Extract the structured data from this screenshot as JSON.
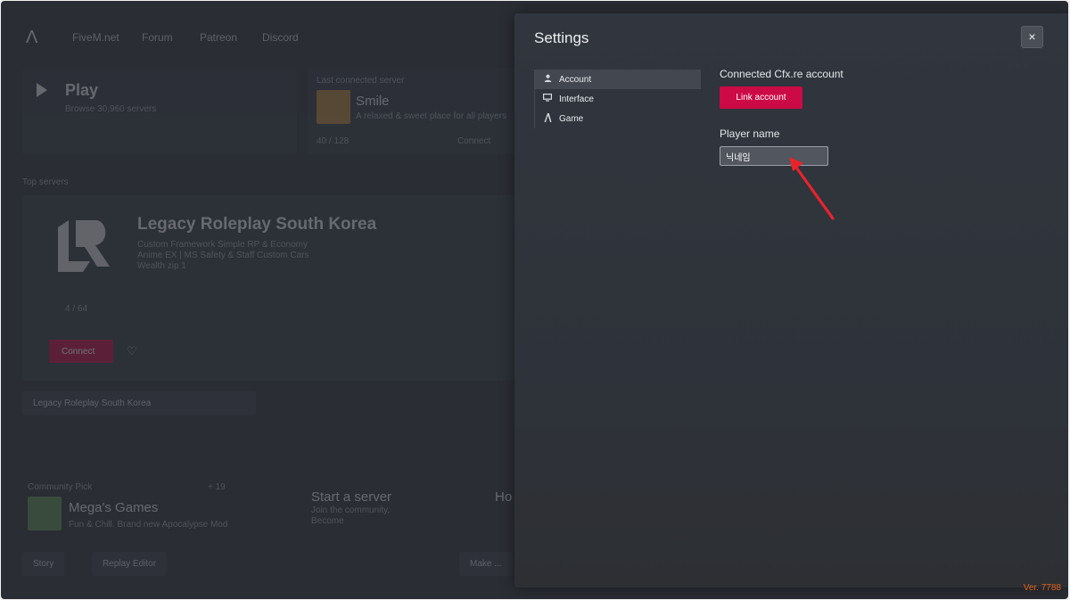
{
  "background": {
    "nav": [
      "FiveM.net",
      "Forum",
      "Patreon",
      "Discord"
    ],
    "play": {
      "title": "Play",
      "subtitle": "Browse 30,960 servers"
    },
    "featured": {
      "label": "Last connected server",
      "title": "Smile",
      "desc": "A relaxed & sweet place for all players",
      "players": "40 / 128",
      "connect": "Connect"
    },
    "top_servers_label": "Top servers",
    "top_server": {
      "title": "Legacy Roleplay South Korea",
      "desc_lines": [
        "Custom Framework Simple RP & Economy",
        "Anime EX | MS Safety & Staff Custom Cars",
        "Wealth zip 1"
      ],
      "players": "4 / 64",
      "connect": "Connect"
    },
    "pinned": "Legacy Roleplay South Korea",
    "community": {
      "label": "Community Pick",
      "count": "+ 19",
      "title": "Mega's Games",
      "desc": "Fun & Chill. Brand new Apocalypse Mod"
    },
    "start_server": {
      "title": "Start a server",
      "desc_lines": [
        "Join the community,",
        "Become"
      ]
    },
    "host": "Ho",
    "bottom_buttons": [
      "Story",
      "Replay Editor",
      "Make ..."
    ]
  },
  "settings": {
    "title": "Settings",
    "close_label": "×",
    "tabs": [
      {
        "label": "Account",
        "icon": "user-icon",
        "active": true
      },
      {
        "label": "Interface",
        "icon": "monitor-icon",
        "active": false
      },
      {
        "label": "Game",
        "icon": "game-logo-icon",
        "active": false
      }
    ],
    "account": {
      "connected_label": "Connected Cfx.re account",
      "link_button": "Link account",
      "player_name_label": "Player name",
      "player_name_value": "닉네임"
    }
  },
  "version": "Ver. 7788",
  "colors": {
    "accent": "#cc0a45",
    "version": "#e0641e",
    "annotation_arrow": "#e8232c"
  }
}
